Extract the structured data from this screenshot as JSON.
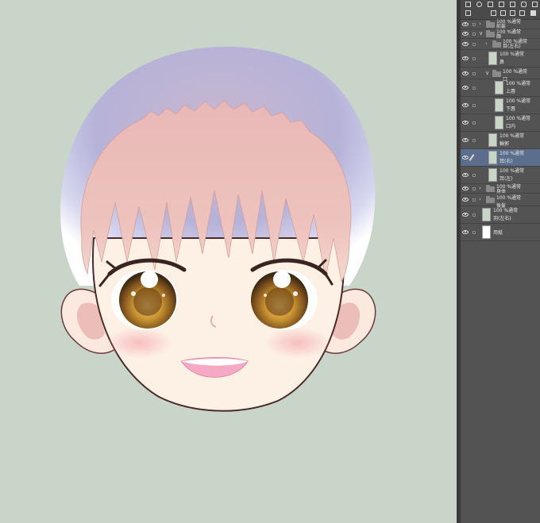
{
  "layers_panel": {
    "toolbar": {
      "icons": [
        "new-raster-layer-icon",
        "new-vector-layer-icon",
        "new-folder-icon",
        "copy-layer-icon",
        "merge-layer-icon",
        "mask-icon",
        "delete-layer-icon"
      ]
    },
    "layers": [
      {
        "blend": "100 %通常",
        "name": "前髪",
        "kind": "folder",
        "indent": 0,
        "expanded": false
      },
      {
        "blend": "100 %通常",
        "name": "顔",
        "kind": "folder",
        "indent": 0,
        "expanded": true
      },
      {
        "blend": "100 %通常",
        "name": "目(左右)",
        "kind": "folder",
        "indent": 1,
        "expanded": false
      },
      {
        "blend": "100 %通常",
        "name": "鼻",
        "kind": "raster",
        "indent": 1
      },
      {
        "blend": "100 %通常",
        "name": "口",
        "kind": "folder",
        "indent": 1,
        "expanded": true
      },
      {
        "blend": "100 %通常",
        "name": "上唇",
        "kind": "raster",
        "indent": 2
      },
      {
        "blend": "100 %通常",
        "name": "下唇",
        "kind": "raster",
        "indent": 2
      },
      {
        "blend": "100 %通常",
        "name": "口内",
        "kind": "raster",
        "indent": 2
      },
      {
        "blend": "100 %通常",
        "name": "輪郭",
        "kind": "raster",
        "indent": 1
      },
      {
        "blend": "100 %通常",
        "name": "耳(右)",
        "kind": "raster",
        "indent": 1,
        "selected": true
      },
      {
        "blend": "100 %通常",
        "name": "耳(左)",
        "kind": "raster",
        "indent": 1
      },
      {
        "blend": "100 %通常",
        "name": "身体",
        "kind": "folder",
        "indent": 0,
        "expanded": false
      },
      {
        "blend": "100 %通常",
        "name": "後髪",
        "kind": "folder",
        "indent": 0,
        "expanded": false
      },
      {
        "blend": "100 %通常",
        "name": "羽(左右)",
        "kind": "raster",
        "indent": 0
      },
      {
        "blend": "",
        "name": "用紙",
        "kind": "paper",
        "indent": 0
      }
    ]
  },
  "colors": {
    "canvas_bg": "#c8d5c8",
    "skin": "#fdf1e6",
    "hair": "#ecbcb8",
    "hood": "#c0bce0",
    "iris": "#c08a2c",
    "panel_bg": "#535353",
    "selected_layer": "#5b6f8c"
  }
}
